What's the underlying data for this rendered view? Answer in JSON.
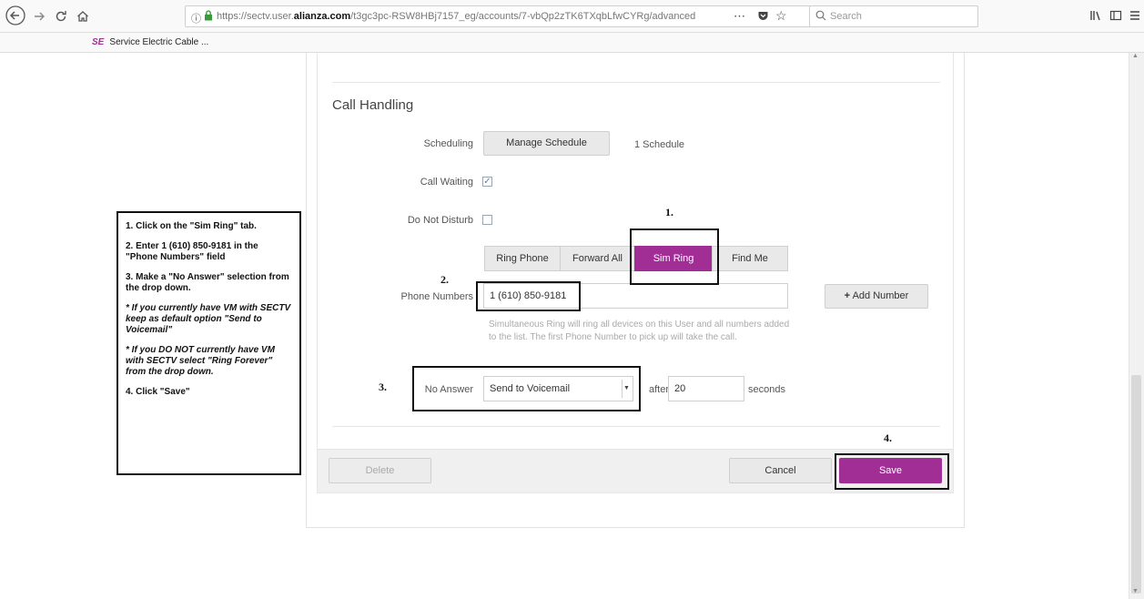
{
  "browser": {
    "url_prefix": "https://sectv.user.",
    "url_domain": "alianza.com",
    "url_suffix": "/t3gc3pc-RSW8HBj7157_eg/accounts/7-vbQp2zTK6TXqbLfwCYRg/advanced",
    "more_label": "⋯",
    "search_placeholder": "Search",
    "bookmark": "Service Electric Cable ..."
  },
  "call_handling": {
    "title": "Call Handling",
    "scheduling_label": "Scheduling",
    "manage_schedule_button": "Manage Schedule",
    "schedule_count": "1 Schedule",
    "call_waiting_label": "Call Waiting",
    "call_waiting_checked": "✓",
    "dnd_label": "Do Not Disturb",
    "tabs": [
      "Ring Phone",
      "Forward All",
      "Sim Ring",
      "Find Me"
    ],
    "phone_numbers_label": "Phone Numbers",
    "phone_number_value": "1 (610) 850-9181",
    "add_number_button": "Add Number",
    "help_text": "Simultaneous Ring will ring all devices on this User and all numbers added to the list. The first Phone Number to pick up will take the call.",
    "no_answer_label": "No Answer",
    "no_answer_value": "Send to Voicemail",
    "after_label": "after",
    "seconds_value": "20",
    "seconds_label": "seconds"
  },
  "footer": {
    "delete": "Delete",
    "cancel": "Cancel",
    "save": "Save"
  },
  "annotations": {
    "n1": "1.",
    "n2": "2.",
    "n3": "3.",
    "n4": "4."
  },
  "instructions": {
    "step1": "1. Click on the \"Sim Ring\" tab.",
    "step2": "2. Enter 1 (610) 850-9181 in the \"Phone Numbers\" field",
    "step3": "3. Make a \"No Answer\" selection from the drop down.",
    "note1": "* If you currently have VM with SECTV keep as default option \"Send to Voicemail\"",
    "note2": "* If you DO NOT currently have VM with SECTV select \"Ring Forever\" from the drop down.",
    "step4": "4. Click \"Save\""
  },
  "colors": {
    "accent": "#a12e95"
  }
}
